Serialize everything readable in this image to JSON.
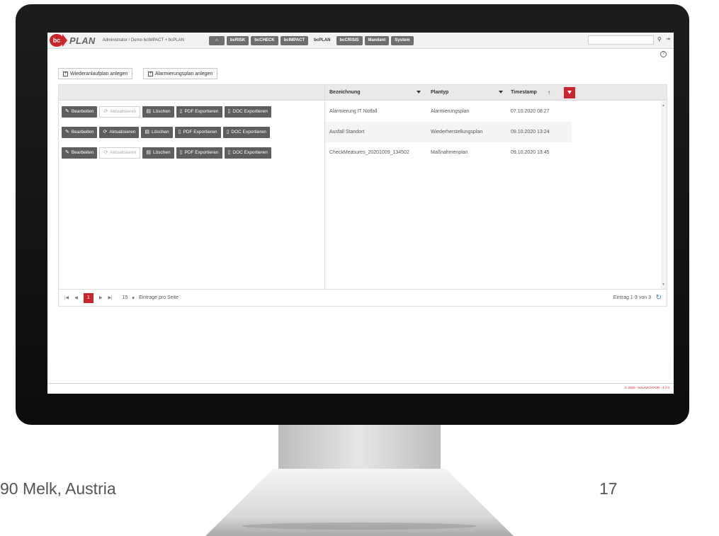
{
  "app": {
    "logo_badge": "bc",
    "logo_text": "PLAN",
    "user_info": "Administrator / Demo bcIMPACT + bcPLAN",
    "nav": [
      {
        "label": "bcRISK"
      },
      {
        "label": "bcCHECK"
      },
      {
        "label": "bcIMPACT"
      },
      {
        "label": "bcPLAN"
      },
      {
        "label": "bcCRISIS"
      },
      {
        "label": "Mandant"
      },
      {
        "label": "System"
      }
    ],
    "home_icon": "home-icon",
    "create_buttons": [
      "Wiederanlaufplan anlegen",
      "Alarmierungsplan anlegen"
    ]
  },
  "table": {
    "columns": [
      "Bezeichnung",
      "Plantyp",
      "Timestamp"
    ],
    "sort_indicator": "↑",
    "actions": [
      "Bearbeiten",
      "Aktualisieren",
      "Löschen",
      "PDF Exportieren",
      "DOC Exportieren"
    ],
    "rows": [
      {
        "name": "Alarmierung IT Notfall",
        "type": "Alarmierungsplan",
        "timestamp": "07.10.2020 08:27",
        "update_enabled": false
      },
      {
        "name": "Ausfall Standort",
        "type": "Wiederherstellungsplan",
        "timestamp": "09.10.2020 13:24",
        "update_enabled": true
      },
      {
        "name": "CheckMeasures_20201009_134502",
        "type": "Maßnahmenplan",
        "timestamp": "09.10.2020 13:45",
        "update_enabled": false
      }
    ]
  },
  "pager": {
    "current_page": "1",
    "page_size": "15",
    "page_size_label": "Eintrage pro Seite",
    "info": "Eintrag 1-3 von 3"
  },
  "copyright": "© 2020 - bcNAVIGATOR - 4.7.0",
  "slide": {
    "footer_left": "90 Melk, Austria",
    "footer_right": "17"
  },
  "colors": {
    "accent": "#c9252c",
    "button": "#5e5e5e",
    "refresh": "#2d7fd3"
  }
}
